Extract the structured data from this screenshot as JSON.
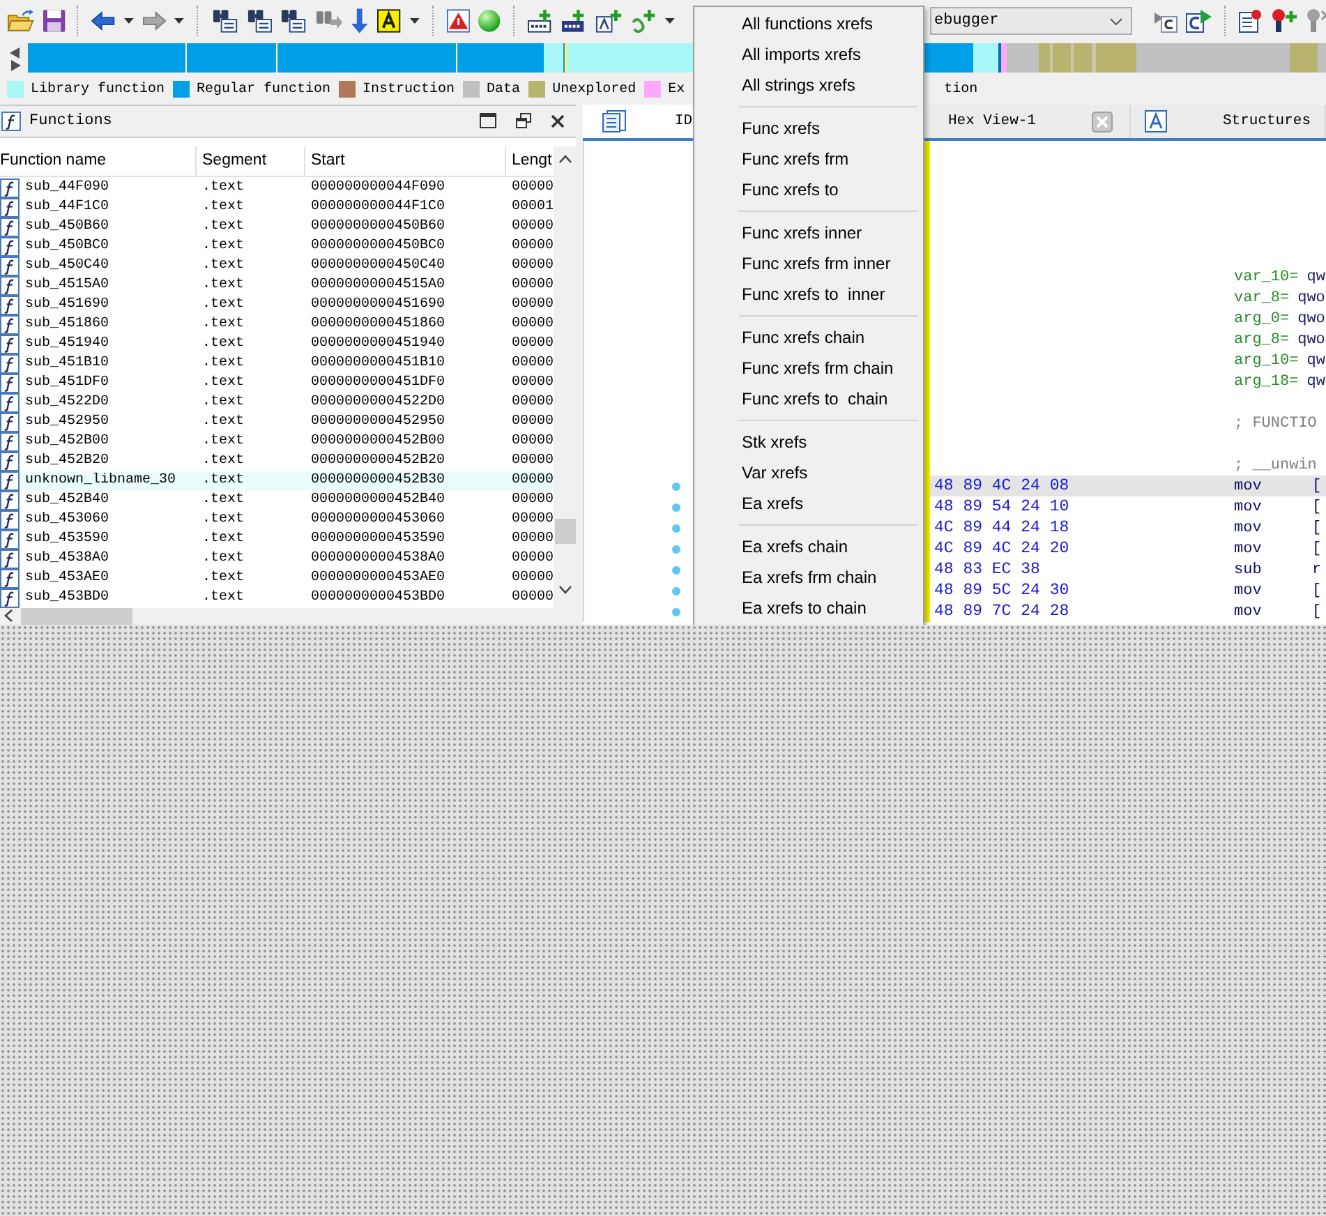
{
  "toolbar": {
    "debugger_select": "ebugger"
  },
  "legend": [
    {
      "label": "Library function",
      "color": "#a8f8f8"
    },
    {
      "label": "Regular function",
      "color": "#00a0e8"
    },
    {
      "label": "Instruction",
      "color": "#b07858"
    },
    {
      "label": "Data",
      "color": "#c0c0c0"
    },
    {
      "label": "Unexplored",
      "color": "#b8b470"
    },
    {
      "label": "Ex",
      "color": "#ffa8ff"
    }
  ],
  "legend_tail": "tion",
  "functions_window": {
    "title": "Functions",
    "columns": [
      "Function name",
      "Segment",
      "Start",
      "Lengt"
    ],
    "rows": [
      {
        "name": "sub_44F090",
        "segment": ".text",
        "start": "000000000044F090",
        "length": "00000",
        "library": false
      },
      {
        "name": "sub_44F1C0",
        "segment": ".text",
        "start": "000000000044F1C0",
        "length": "00001",
        "library": false
      },
      {
        "name": "sub_450B60",
        "segment": ".text",
        "start": "0000000000450B60",
        "length": "00000",
        "library": false
      },
      {
        "name": "sub_450BC0",
        "segment": ".text",
        "start": "0000000000450BC0",
        "length": "00000",
        "library": false
      },
      {
        "name": "sub_450C40",
        "segment": ".text",
        "start": "0000000000450C40",
        "length": "00000",
        "library": false
      },
      {
        "name": "sub_4515A0",
        "segment": ".text",
        "start": "00000000004515A0",
        "length": "00000",
        "library": false
      },
      {
        "name": "sub_451690",
        "segment": ".text",
        "start": "0000000000451690",
        "length": "00000",
        "library": false
      },
      {
        "name": "sub_451860",
        "segment": ".text",
        "start": "0000000000451860",
        "length": "00000",
        "library": false
      },
      {
        "name": "sub_451940",
        "segment": ".text",
        "start": "0000000000451940",
        "length": "00000",
        "library": false
      },
      {
        "name": "sub_451B10",
        "segment": ".text",
        "start": "0000000000451B10",
        "length": "00000",
        "library": false
      },
      {
        "name": "sub_451DF0",
        "segment": ".text",
        "start": "0000000000451DF0",
        "length": "00000",
        "library": false
      },
      {
        "name": "sub_4522D0",
        "segment": ".text",
        "start": "00000000004522D0",
        "length": "00000",
        "library": false
      },
      {
        "name": "sub_452950",
        "segment": ".text",
        "start": "0000000000452950",
        "length": "00000",
        "library": false
      },
      {
        "name": "sub_452B00",
        "segment": ".text",
        "start": "0000000000452B00",
        "length": "00000",
        "library": false
      },
      {
        "name": "sub_452B20",
        "segment": ".text",
        "start": "0000000000452B20",
        "length": "00000",
        "library": false
      },
      {
        "name": "unknown_libname_30",
        "segment": ".text",
        "start": "0000000000452B30",
        "length": "00000",
        "library": true
      },
      {
        "name": "sub_452B40",
        "segment": ".text",
        "start": "0000000000452B40",
        "length": "00000",
        "library": false
      },
      {
        "name": "sub_453060",
        "segment": ".text",
        "start": "0000000000453060",
        "length": "00000",
        "library": false
      },
      {
        "name": "sub_453590",
        "segment": ".text",
        "start": "0000000000453590",
        "length": "00000",
        "library": false
      },
      {
        "name": "sub_4538A0",
        "segment": ".text",
        "start": "00000000004538A0",
        "length": "00000",
        "library": false
      },
      {
        "name": "sub_453AE0",
        "segment": ".text",
        "start": "0000000000453AE0",
        "length": "00000",
        "library": false
      },
      {
        "name": "sub_453BD0",
        "segment": ".text",
        "start": "0000000000453BD0",
        "length": "00000",
        "library": false
      }
    ]
  },
  "tabs": [
    {
      "label": "ID",
      "selected": true,
      "kind": "listing"
    },
    {
      "label": "Hex View-1",
      "selected": false,
      "kind": "hex"
    },
    {
      "label": "Structures",
      "selected": false,
      "kind": "structs"
    }
  ],
  "listing": [
    {
      "kind": "blank"
    },
    {
      "kind": "blank"
    },
    {
      "kind": "blank"
    },
    {
      "kind": "blank"
    },
    {
      "kind": "blank"
    },
    {
      "kind": "blank"
    },
    {
      "kind": "var",
      "name": "var_10=",
      "value": "qw"
    },
    {
      "kind": "var",
      "name": "var_8=",
      "value": "qwo"
    },
    {
      "kind": "var",
      "name": "arg_0=",
      "value": "qwo"
    },
    {
      "kind": "var",
      "name": "arg_8=",
      "value": "qwo"
    },
    {
      "kind": "var",
      "name": "arg_10=",
      "value": "qw"
    },
    {
      "kind": "var",
      "name": "arg_18=",
      "value": "qw"
    },
    {
      "kind": "blank"
    },
    {
      "kind": "comment",
      "text": "; FUNCTIO"
    },
    {
      "kind": "blank"
    },
    {
      "kind": "comment",
      "text": "; __unwin"
    },
    {
      "kind": "code",
      "bytes": "48 89 4C 24 08",
      "mnemonic": "mov",
      "operand": "[",
      "current": true
    },
    {
      "kind": "code",
      "bytes": "48 89 54 24 10",
      "mnemonic": "mov",
      "operand": "[",
      "current": false
    },
    {
      "kind": "code",
      "bytes": "4C 89 44 24 18",
      "mnemonic": "mov",
      "operand": "[",
      "current": false
    },
    {
      "kind": "code",
      "bytes": "4C 89 4C 24 20",
      "mnemonic": "mov",
      "operand": "[",
      "current": false
    },
    {
      "kind": "code",
      "bytes": "48 83 EC 38",
      "mnemonic": "sub",
      "operand": "r",
      "current": false
    },
    {
      "kind": "code",
      "bytes": "48 89 5C 24 30",
      "mnemonic": "mov",
      "operand": "[",
      "current": false
    },
    {
      "kind": "code",
      "bytes": "48 89 7C 24 28",
      "mnemonic": "mov",
      "operand": "[",
      "current": false
    }
  ],
  "context_menu": {
    "groups": [
      [
        "All functions xrefs",
        "All imports xrefs",
        "All strings xrefs"
      ],
      [
        "Func xrefs",
        "Func xrefs frm",
        "Func xrefs to"
      ],
      [
        "Func xrefs inner",
        "Func xrefs frm inner",
        "Func xrefs to  inner"
      ],
      [
        "Func xrefs chain",
        "Func xrefs frm chain",
        "Func xrefs to  chain"
      ],
      [
        "Stk xrefs",
        "Var xrefs",
        "Ea xrefs"
      ],
      [
        "Ea xrefs chain",
        "Ea xrefs frm chain",
        "Ea xrefs to chain"
      ]
    ]
  }
}
